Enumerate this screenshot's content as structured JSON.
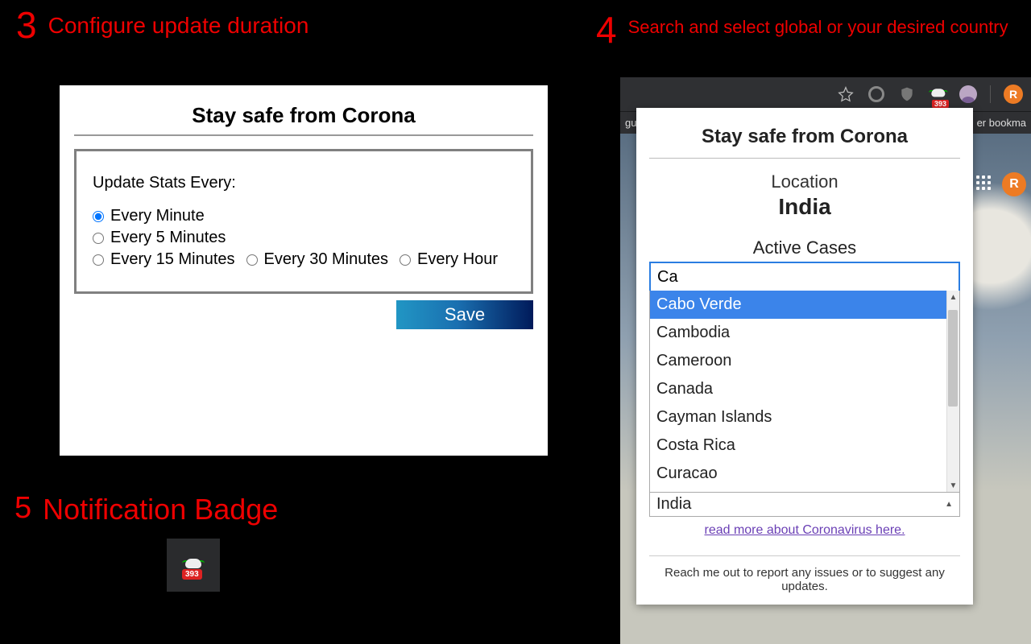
{
  "step3": {
    "num": "3",
    "text": "Configure update duration",
    "title": "Stay safe from Corona",
    "updateLabel": "Update Stats Every:",
    "options": {
      "o1": "Every Minute",
      "o2": "Every 5 Minutes",
      "o3": "Every 15 Minutes",
      "o4": "Every 30 Minutes",
      "o5": "Every Hour"
    },
    "saveLabel": "Save"
  },
  "step4": {
    "num": "4",
    "text": "Search and select global or your desired country",
    "toolbar": {
      "badge": "393",
      "avatarLetter": "R",
      "bookmarksLeft": "guid",
      "bookmarksRight": "er bookma",
      "pageAvatarLetter": "R"
    },
    "popup": {
      "title": "Stay safe from Corona",
      "locationLabel": "Location",
      "locationValue": "India",
      "sectionLabel": "Active Cases",
      "searchValue": "Ca",
      "results": {
        "r0": "Cabo Verde",
        "r1": "Cambodia",
        "r2": "Cameroon",
        "r3": "Canada",
        "r4": "Cayman Islands",
        "r5": "Costa Rica",
        "r6": "Curacao"
      },
      "selected": "India",
      "readMore": "read more about Coronavirus here.",
      "reachOut": "Reach me out to report any issues or to suggest any updates."
    }
  },
  "step5": {
    "num": "5",
    "text": "Notification Badge",
    "badge": "393"
  }
}
